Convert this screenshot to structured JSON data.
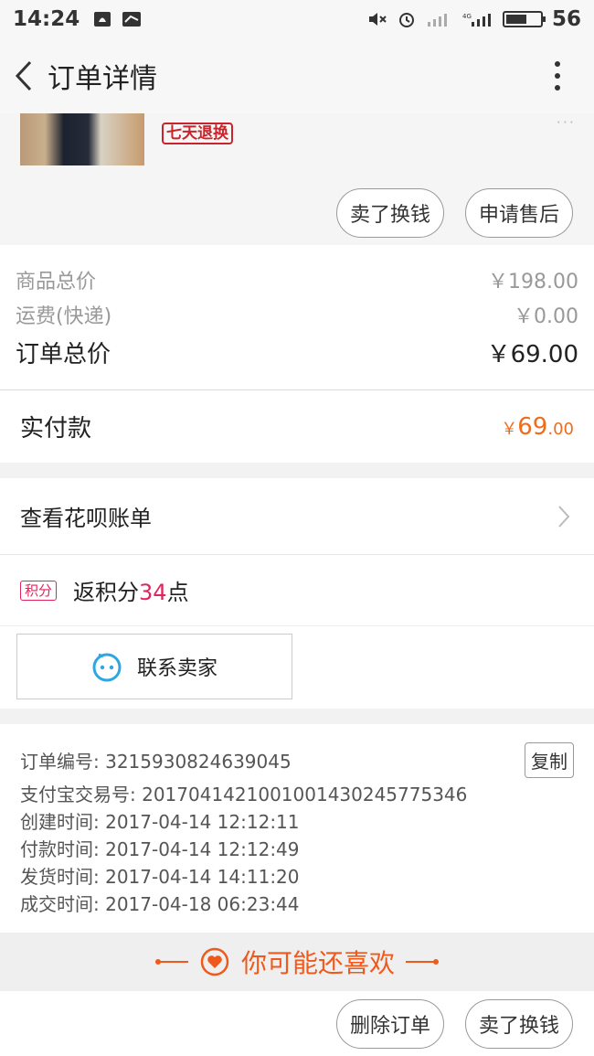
{
  "status_bar": {
    "time": "14:24",
    "battery": "56",
    "network": "4G"
  },
  "header": {
    "title": "订单详情"
  },
  "product": {
    "badge": "七天退换",
    "more": "···"
  },
  "actions_top": {
    "sell": "卖了换钱",
    "after_sale": "申请售后"
  },
  "prices": {
    "goods_label": "商品总价",
    "goods_value": "￥198.00",
    "shipping_label": "运费(快递)",
    "shipping_value": "￥0.00",
    "total_label": "订单总价",
    "total_value": "￥69.00"
  },
  "paid": {
    "label": "实付款",
    "currency": "￥",
    "main": "69",
    "decimal": ".00"
  },
  "huabei": {
    "label": "查看花呗账单"
  },
  "points": {
    "badge": "积分",
    "prefix": "返积分",
    "num": "34",
    "suffix": "点"
  },
  "contact": {
    "label": "联系卖家"
  },
  "order_info": {
    "order_no": "订单编号: 3215930824639045",
    "copy": "复制",
    "alipay_no": "支付宝交易号: 2017041421001001430245775346",
    "created": "创建时间: 2017-04-14 12:12:11",
    "paid": "付款时间: 2017-04-14 12:12:49",
    "shipped": "发货时间: 2017-04-14 14:11:20",
    "completed": "成交时间: 2017-04-18 06:23:44"
  },
  "guess": {
    "label": "你可能还喜欢"
  },
  "bottom": {
    "delete": "删除订单",
    "sell": "卖了换钱"
  },
  "colors": {
    "accent_orange": "#ef6c1c",
    "points_pink": "#e0245e",
    "badge_red": "#c9242b",
    "icon_blue": "#2ea7e0"
  }
}
